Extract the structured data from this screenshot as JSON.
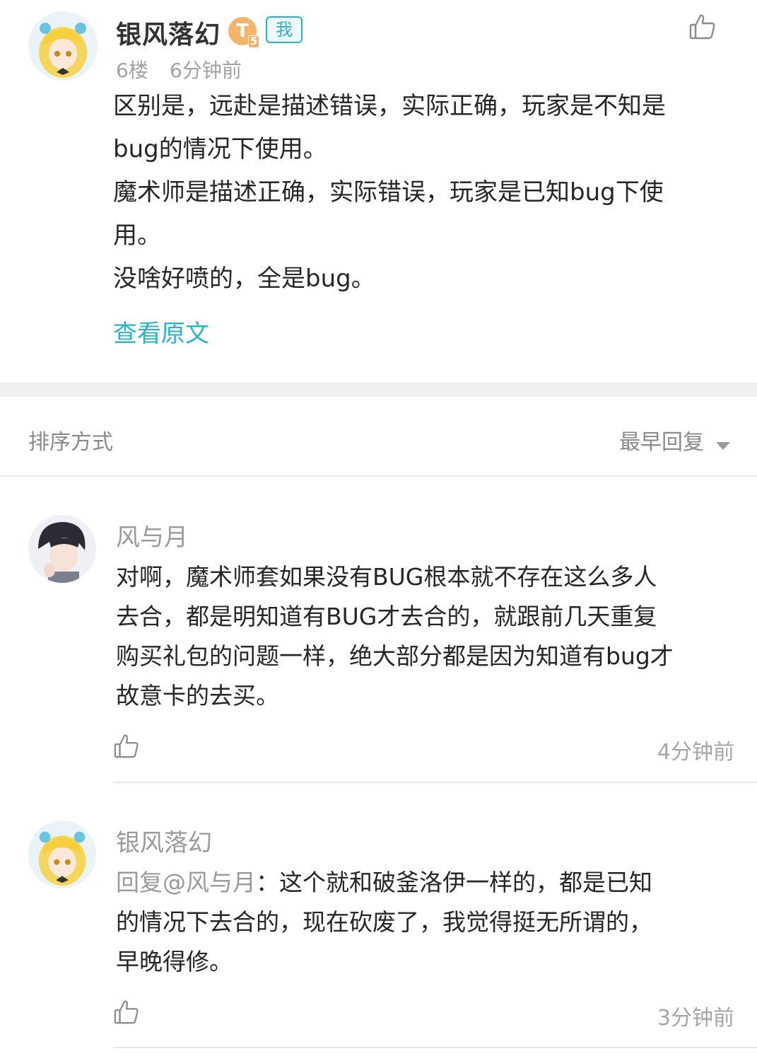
{
  "post": {
    "username": "银风落幻",
    "level_badge": "T",
    "level_sub": "5",
    "me_badge": "我",
    "floor": "6楼",
    "time": "6分钟前",
    "lines": [
      "区别是，远赴是描述错误，实际正确，玩家是不知是",
      "bug的情况下使用。",
      "魔术师是描述正确，实际错误，玩家是已知bug下使",
      "用。",
      "没啥好喷的，全是bug。"
    ],
    "view_original": "查看原文",
    "like_icon": "thumbs-up-icon"
  },
  "sort": {
    "label": "排序方式",
    "value": "最早回复",
    "icon": "triangle-down-icon"
  },
  "replies": [
    {
      "username": "风与月",
      "lines": [
        "对啊，魔术师套如果没有BUG根本就不存在这么多人",
        "去合，都是明知道有BUG才去合的，就跟前几天重复",
        "购买礼包的问题一样，绝大部分都是因为知道有bug才",
        "故意卡的去买。"
      ],
      "time": "4分钟前"
    },
    {
      "username": "银风落幻",
      "mention": "回复@风与月",
      "lines": [
        "：这个就和破釜洛伊一样的，都是已知",
        "的情况下去合的，现在砍废了，我觉得挺无所谓的，",
        "早晚得修。"
      ],
      "time": "3分钟前"
    }
  ],
  "colors": {
    "accent": "#2bb3c4",
    "level_badge": "#f4b46b",
    "separator_band": "#efefef"
  }
}
